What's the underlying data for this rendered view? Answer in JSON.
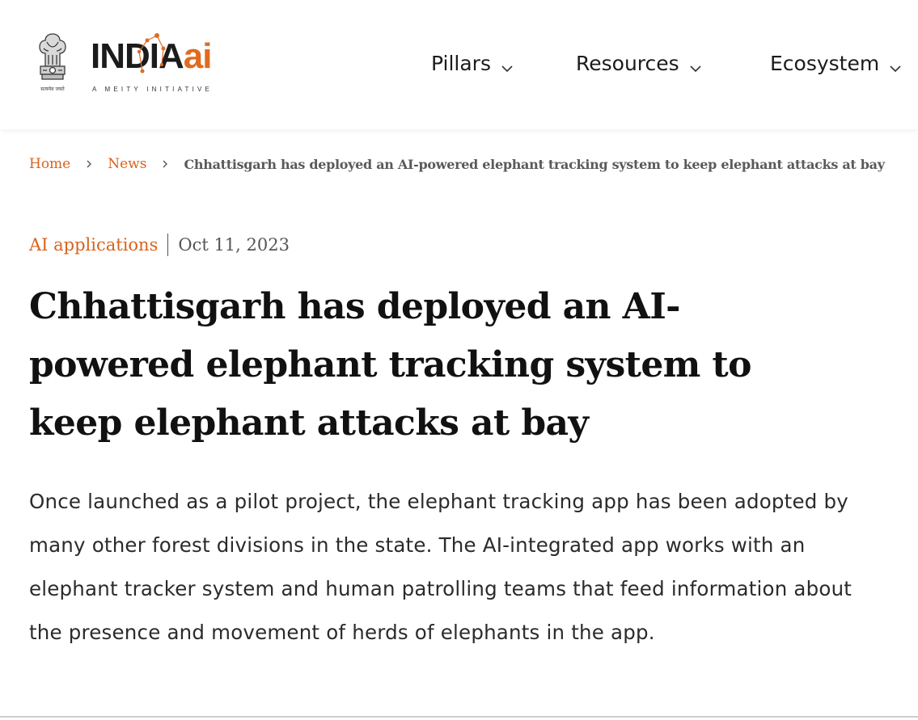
{
  "brand": {
    "name_part1": "INDIA",
    "name_part2": "ai",
    "tagline": "A MEITY INITIATIVE",
    "emblem_caption": "सत्यमेव जयते",
    "accent_color": "#e06b1f"
  },
  "nav": {
    "items": [
      {
        "label": "Pillars",
        "icon": "chevron-down-icon"
      },
      {
        "label": "Resources",
        "icon": "chevron-down-icon"
      },
      {
        "label": "Ecosystem",
        "icon": "chevron-down-icon"
      }
    ]
  },
  "breadcrumb": {
    "home": "Home",
    "section": "News",
    "separator_icon": "chevron-right-icon",
    "current": "Chhattisgarh has deployed an AI-powered elephant tracking system to keep elephant attacks at bay"
  },
  "article": {
    "category": "AI applications",
    "date": "Oct 11, 2023",
    "title": "Chhattisgarh has deployed an AI-powered elephant tracking system to keep elephant attacks at bay",
    "summary": "Once launched as a pilot project, the elephant tracking app has been adopted by many other forest divisions in the state. The AI-integrated app works with an elephant tracker system and human patrolling teams that feed information about the presence and movement of herds of elephants in the app."
  },
  "colors": {
    "link": "#d9621b",
    "text": "#111111",
    "muted": "#555555"
  }
}
